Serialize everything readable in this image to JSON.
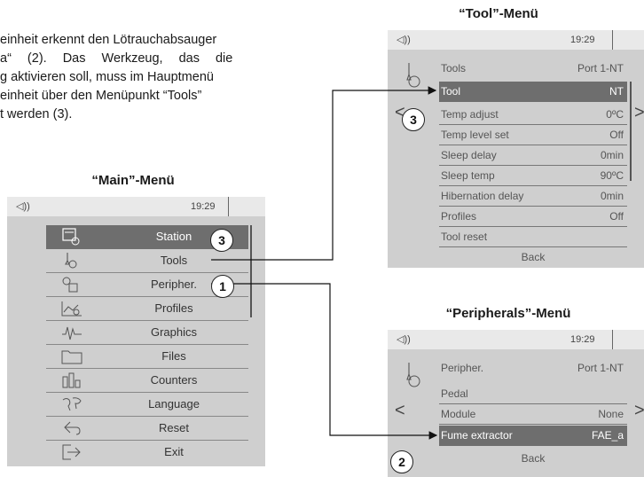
{
  "intro": {
    "line1": "einheit erkennt den Lötrauchabsauger",
    "line2": "a“ (2). Das Werkzeug, das die",
    "line3": "g aktivieren soll, muss im Hauptmenü",
    "line4": "einheit über den Menüpunkt “Tools”",
    "line5": "t werden (3)."
  },
  "captions": {
    "main": "“Main”-Menü",
    "tool": "“Tool”-Menü",
    "peripherals": "“Peripherals”-Menü"
  },
  "status": {
    "speaker_icon": "speaker-icon",
    "time": "19:29"
  },
  "main_menu": {
    "items": [
      {
        "label": "Station",
        "icon": "station-icon",
        "selected": true
      },
      {
        "label": "Tools",
        "icon": "soldering-tool-icon"
      },
      {
        "label": "Peripher.",
        "icon": "peripherals-icon"
      },
      {
        "label": "Profiles",
        "icon": "profiles-icon"
      },
      {
        "label": "Graphics",
        "icon": "graphics-icon"
      },
      {
        "label": "Files",
        "icon": "folder-icon"
      },
      {
        "label": "Counters",
        "icon": "counters-icon"
      },
      {
        "label": "Language",
        "icon": "world-map-icon"
      },
      {
        "label": "Reset",
        "icon": "reset-icon"
      },
      {
        "label": "Exit",
        "icon": "exit-icon"
      }
    ]
  },
  "tool_menu": {
    "header": {
      "label": "Tools",
      "value": "Port 1-NT"
    },
    "rows": [
      {
        "label": "Tool",
        "value": "NT",
        "selected": true
      },
      {
        "label": "Temp adjust",
        "value": "0ºC"
      },
      {
        "label": "Temp level set",
        "value": "Off"
      },
      {
        "label": "Sleep delay",
        "value": "0min"
      },
      {
        "label": "Sleep temp",
        "value": "90ºC"
      },
      {
        "label": "Hibernation delay",
        "value": "0min"
      },
      {
        "label": "Profiles",
        "value": "Off"
      },
      {
        "label": "Tool reset",
        "value": ""
      }
    ],
    "back": "Back"
  },
  "peripherals_menu": {
    "header": {
      "label": "Peripher.",
      "value": "Port 1-NT"
    },
    "rows": [
      {
        "label": "Pedal",
        "value": ""
      },
      {
        "label": "Module",
        "value": "None"
      },
      {
        "label": "Fume extractor",
        "value": "FAE_a",
        "selected": true
      }
    ],
    "back": "Back"
  },
  "badges": {
    "one": "1",
    "two": "2",
    "three_main": "3",
    "three_tool": "3"
  },
  "arrows": {
    "left": "<",
    "right": ">"
  }
}
